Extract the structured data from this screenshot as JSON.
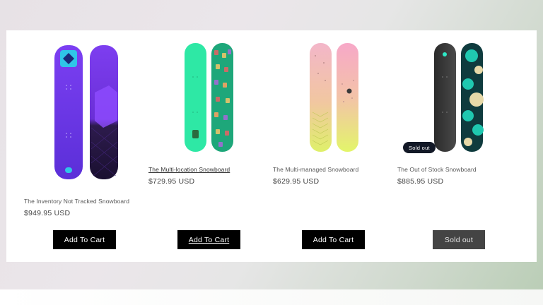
{
  "products": [
    {
      "title": "The Inventory Not Tracked Snowboard",
      "price": "$949.95 USD",
      "button_label": "Add To Cart",
      "image_alt": "purple-snowboard-pair"
    },
    {
      "title": "The Multi-location Snowboard",
      "price": "$729.95 USD",
      "button_label": "Add To Cart",
      "image_alt": "green-snowboard-pair"
    },
    {
      "title": "The Multi-managed Snowboard",
      "price": "$629.95 USD",
      "button_label": "Add To Cart",
      "image_alt": "pink-yellow-snowboard-pair"
    },
    {
      "title": "The Out of Stock Snowboard",
      "price": "$885.95 USD",
      "button_label": "Sold out",
      "badge": "Sold out",
      "image_alt": "dark-teal-snowboard-pair"
    }
  ],
  "colors": {
    "button": "#000000",
    "button_disabled": "#444444",
    "badge": "#121826"
  }
}
